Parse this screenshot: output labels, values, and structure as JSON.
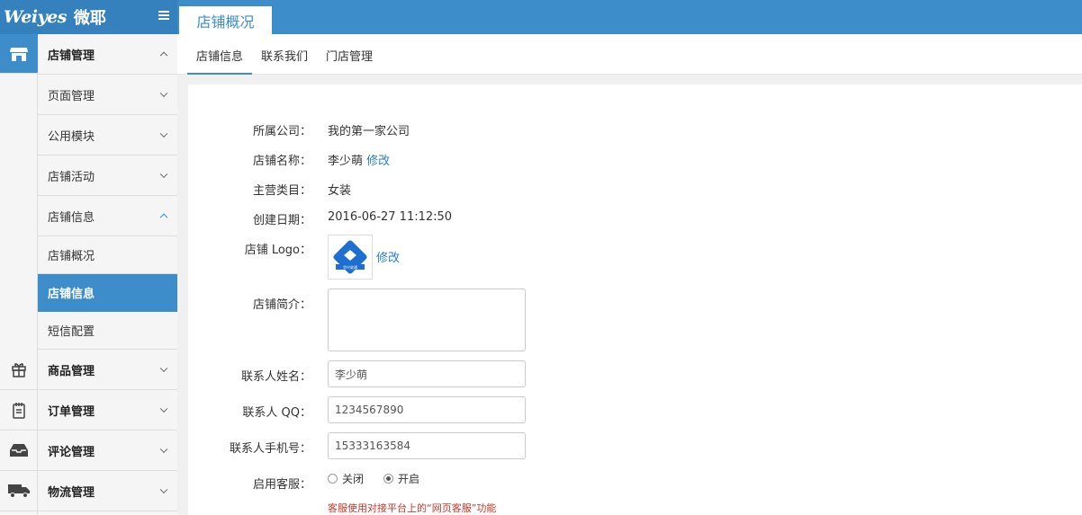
{
  "brand": {
    "logo_en": "Weiyes",
    "logo_cn": "微耶"
  },
  "top_tab": {
    "label": "店铺概况"
  },
  "sidebar": {
    "groups": [
      {
        "label": "店铺管理",
        "icon": "store-icon"
      },
      {
        "label": "页面管理"
      },
      {
        "label": "公用模块"
      },
      {
        "label": "店铺活动"
      },
      {
        "label": "店铺信息"
      },
      {
        "label": "店铺概况"
      },
      {
        "label": "店铺信息"
      },
      {
        "label": "短信配置"
      },
      {
        "label": "商品管理",
        "icon": "gift-icon"
      },
      {
        "label": "订单管理",
        "icon": "notepad-icon"
      },
      {
        "label": "评论管理",
        "icon": "inbox-icon"
      },
      {
        "label": "物流管理",
        "icon": "truck-icon"
      }
    ]
  },
  "subnav": {
    "tabs": [
      "店铺信息",
      "联系我们",
      "门店管理"
    ]
  },
  "form": {
    "company_label": "所属公司：",
    "company_value": "我的第一家公司",
    "name_label": "店铺名称：",
    "name_value": "李少萌",
    "edit_link": "修改",
    "category_label": "主营类目：",
    "category_value": "女装",
    "created_label": "创建日期：",
    "created_value": "2016-06-27 11:12:50",
    "logo_label": "店铺 Logo：",
    "logo_caption_cn": "华兴软通",
    "logo_edit": "修改",
    "intro_label": "店铺简介：",
    "contact_name_label": "联系人姓名：",
    "contact_name_value": "李少萌",
    "qq_label": "联系人 QQ：",
    "qq_value": "1234567890",
    "phone_label": "联系人手机号：",
    "phone_value": "15333163584",
    "service_label": "启用客服：",
    "service_off": "关闭",
    "service_on": "开启",
    "service_note": "客服使用对接平台上的“网页客服”功能"
  },
  "colors": {
    "accent": "#3c8dca",
    "link": "#2a7fcf",
    "warning": "#c0392b"
  }
}
